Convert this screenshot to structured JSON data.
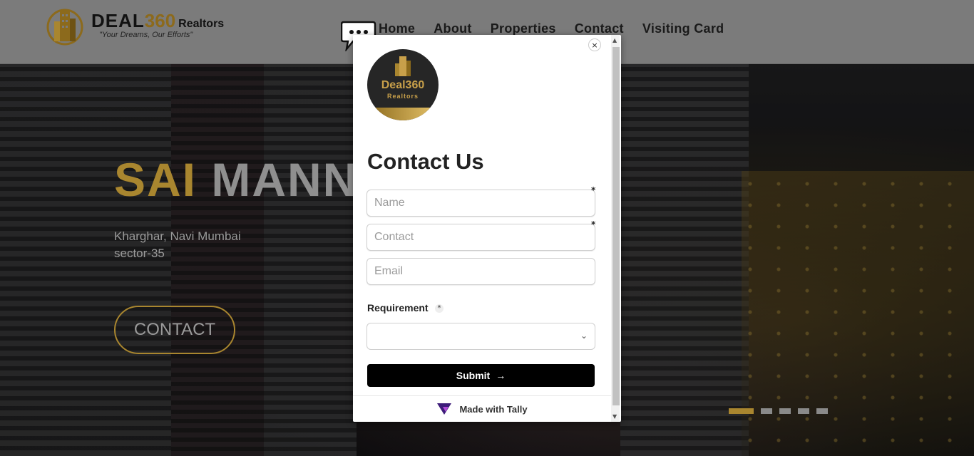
{
  "header": {
    "brand_name": "DEAL",
    "brand_number": "360",
    "brand_suffix": "Realtors",
    "tagline": "\"Your Dreams, Our Efforts\"",
    "nav": [
      "Home",
      "About",
      "Properties",
      "Contact",
      "Visiting Card"
    ]
  },
  "hero": {
    "title_part1": "SAI",
    "title_part2": "MANN",
    "location_line1": "Kharghar, Navi Mumbai",
    "location_line2": "sector-35",
    "cta_label": "CONTACT",
    "slides_total": 5,
    "slide_active": 1
  },
  "modal": {
    "close_symbol": "×",
    "logo_text": "Deal360",
    "logo_sub": "Realtors",
    "title": "Contact Us",
    "fields": {
      "name_placeholder": "Name",
      "contact_placeholder": "Contact",
      "email_placeholder": "Email"
    },
    "requirement_label": "Requirement",
    "required_mark": "*",
    "submit_label": "Submit",
    "footer_text": "Made with Tally"
  },
  "colors": {
    "accent_gold": "#a9862f",
    "header_bg": "#7b7b7b"
  }
}
